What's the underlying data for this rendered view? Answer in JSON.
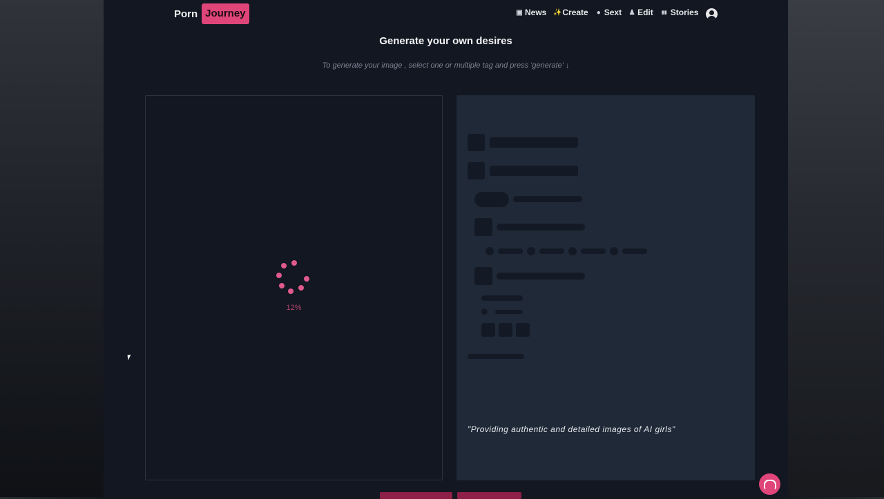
{
  "brand": {
    "part1": "Porn",
    "part2": "Journey",
    "accent": "#e0457a"
  },
  "nav": {
    "items": [
      {
        "icon": "newspaper-icon",
        "glyph": "▣",
        "label": "News"
      },
      {
        "icon": "sparkles-icon",
        "glyph": "✨",
        "label": "Create"
      },
      {
        "icon": "chat-bubble-icon",
        "glyph": "●",
        "label": "Sext"
      },
      {
        "icon": "person-icon",
        "glyph": "♟",
        "label": "Edit"
      },
      {
        "icon": "book-icon",
        "glyph": "▮▮",
        "label": "Stories"
      }
    ]
  },
  "page": {
    "title": "Generate your own desires",
    "subtitle": "To generate your image , select one or multiple tag and press 'generate' ↓"
  },
  "generator": {
    "progress": "12%",
    "progress_value": 0.12
  },
  "info_panel": {
    "quote": "\"Providing authentic and detailed images of AI girls\""
  },
  "colors": {
    "page_bg": "#121722",
    "panel_bg": "#1f2937",
    "spinner": "#e05a8e"
  }
}
